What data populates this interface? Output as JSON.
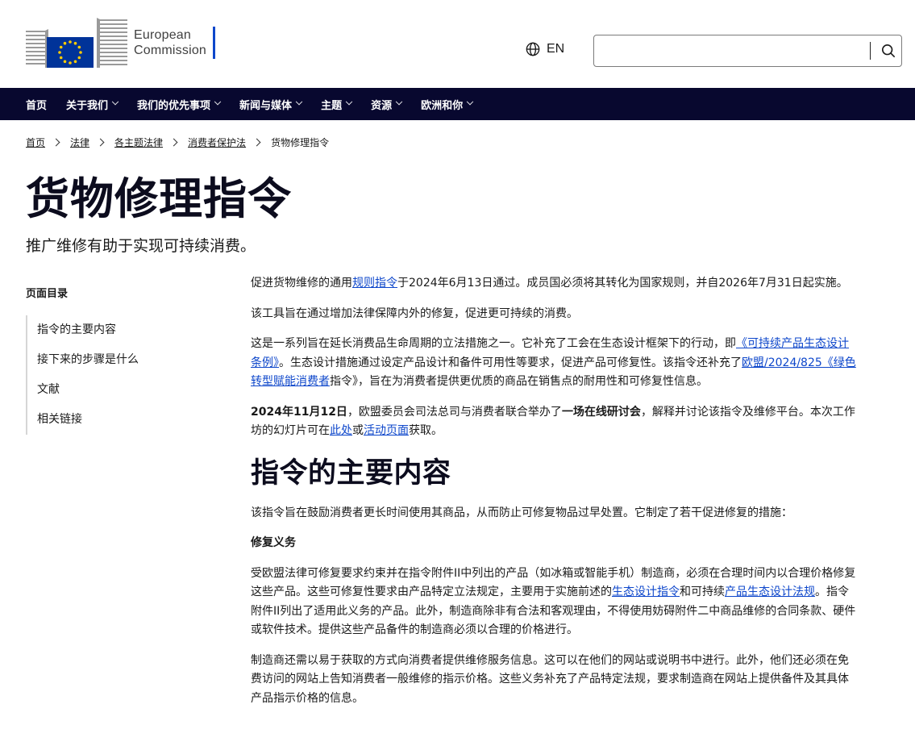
{
  "header": {
    "logo_line1": "European",
    "logo_line2": "Commission",
    "language": "EN",
    "search_placeholder": ""
  },
  "nav": {
    "items": [
      {
        "label": "首页",
        "dropdown": false
      },
      {
        "label": "关于我们",
        "dropdown": true
      },
      {
        "label": "我们的优先事项",
        "dropdown": true
      },
      {
        "label": "新闻与媒体",
        "dropdown": true
      },
      {
        "label": "主题",
        "dropdown": true
      },
      {
        "label": "资源",
        "dropdown": true
      },
      {
        "label": "欧洲和你",
        "dropdown": true
      }
    ]
  },
  "breadcrumb": [
    "首页",
    "法律",
    "各主题法律",
    "消费者保护法",
    "货物修理指令"
  ],
  "page": {
    "title": "货物修理指令",
    "subtitle": "推广维修有助于实现可持续消费。"
  },
  "toc": {
    "title": "页面目录",
    "items": [
      "指令的主要内容",
      "接下来的步骤是什么",
      "文献",
      "相关链接"
    ]
  },
  "content": {
    "p1": {
      "a": "促进货物维修的通用",
      "link": "规则指令",
      "b": "于2024年6月13日通过。成员国必须将其转化为国家规则，并自2026年7月31日起实施。"
    },
    "p2": "该工具旨在通过增加法律保障内外的修复，促进更可持续的消费。",
    "p3": {
      "a": "这是一系列旨在延长消费品生命周期的立法措施之一。它补充了工会在生态设计框架下的行动，即",
      "link1": "《可持续产品生态设计条例》",
      "b": "。生态设计措施通过设定产品设计和备件可用性等要求，促进产品可修复性。该指令还补充了",
      "link2": "欧盟/2024/825《绿色转型赋能消费者",
      "c": "指令》，旨在为消费者提供更优质的商品在销售点的耐用性和可修复性信息。"
    },
    "p4": {
      "date": "2024年11月12日",
      "a": "，欧盟委员会司法总司与消费者联合举办了",
      "bold2": "一场在线研讨会",
      "b": "，解释并讨论该指令及维修平台。本次工作坊的幻灯片可在",
      "link1": "此处",
      "c": "或",
      "link2": "活动页面",
      "d": "获取。"
    },
    "h2": "指令的主要内容",
    "p5": "该指令旨在鼓励消费者更长时间使用其商品，从而防止可修复物品过早处置。它制定了若干促进修复的措施：",
    "h4": "修复义务",
    "p6": {
      "a": "受欧盟法律可修复要求约束并在指令附件II中列出的产品（如冰箱或智能手机）制造商，必须在合理时间内以合理价格修复这些产品。这些可修复性要求由产品特定立法规定，主要用于实施前述的",
      "link1": "生态设计指令",
      "b": "和可持续",
      "link2": "产品生态设计法规",
      "c": "。指令附件II列出了适用此义务的产品。此外，制造商除非有合法和客观理由，不得使用妨碍附件二中商品维修的合同条款、硬件或软件技术。提供这些产品备件的制造商必须以合理的价格进行。"
    },
    "p7": "制造商还需以易于获取的方式向消费者提供维修服务信息。这可以在他们的网站或说明书中进行。此外，他们还必须在免费访问的网站上告知消费者一般维修的指示价格。这些义务补充了产品特定法规，要求制造商在网站上提供备件及其具体产品指示价格的信息。"
  }
}
